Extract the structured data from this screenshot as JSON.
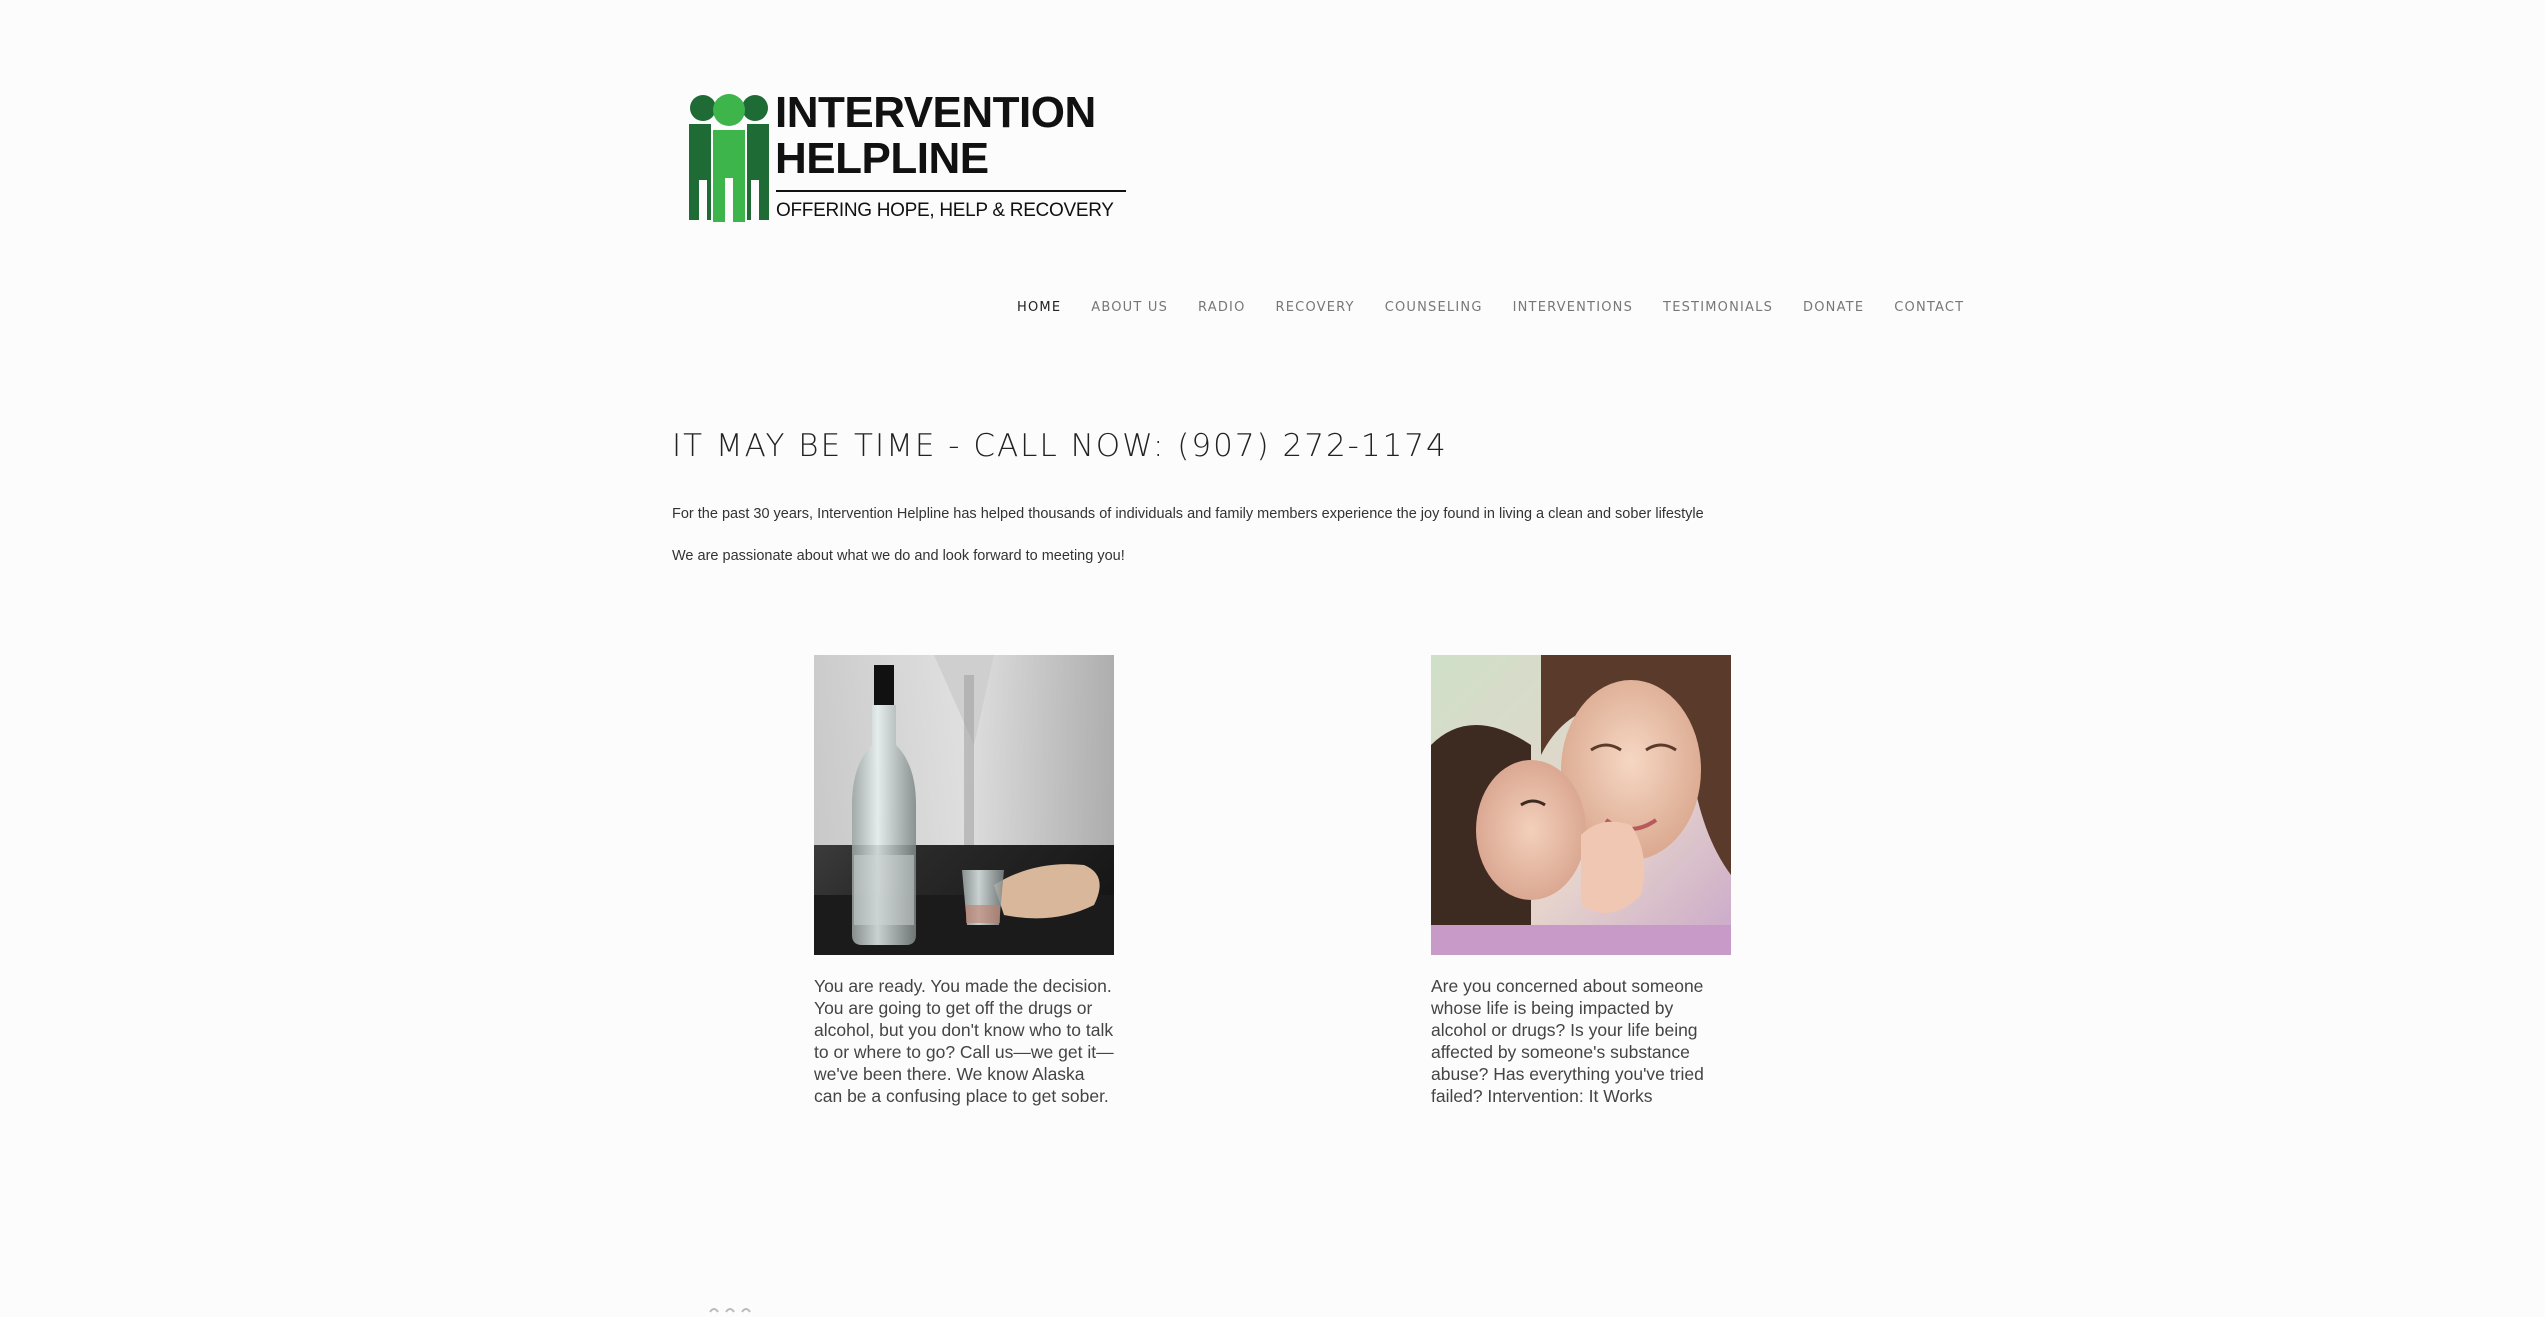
{
  "brand": {
    "title_line1": "INTERVENTION",
    "title_line2": "HELPLINE",
    "tagline": "OFFERING HOPE, HELP & RECOVERY",
    "colors": {
      "green_light": "#3db54a",
      "green_dark": "#1f6b36",
      "text": "#111111"
    }
  },
  "nav": {
    "items": [
      {
        "label": "HOME",
        "active": true
      },
      {
        "label": "ABOUT US"
      },
      {
        "label": "RADIO"
      },
      {
        "label": "RECOVERY"
      },
      {
        "label": "COUNSELING"
      },
      {
        "label": "INTERVENTIONS"
      },
      {
        "label": "TESTIMONIALS"
      },
      {
        "label": "DONATE"
      },
      {
        "label": "CONTACT"
      }
    ]
  },
  "main": {
    "headline": "IT MAY BE TIME - CALL NOW: (907) 272-1174",
    "intro_1": "For the past 30 years, Intervention Helpline has helped thousands of individuals and family members experience the joy found in living a clean and sober lifestyle",
    "intro_2": "We are passionate about what we do and look forward to meeting you!",
    "features": [
      {
        "image": "bottle-and-shot-glass-photo",
        "caption": "You are ready. You made the decision. You are going to get off the drugs or alcohol, but you don't know who to talk to or where to go? Call us—we get it—we've been there. We know Alaska can be a confusing place to get sober."
      },
      {
        "image": "child-kissing-mother-photo",
        "caption": "Are you concerned about someone whose life is being impacted by alcohol or drugs? Is your life being affected by someone's substance abuse? Has everything you've tried failed? Intervention: It Works"
      }
    ]
  }
}
